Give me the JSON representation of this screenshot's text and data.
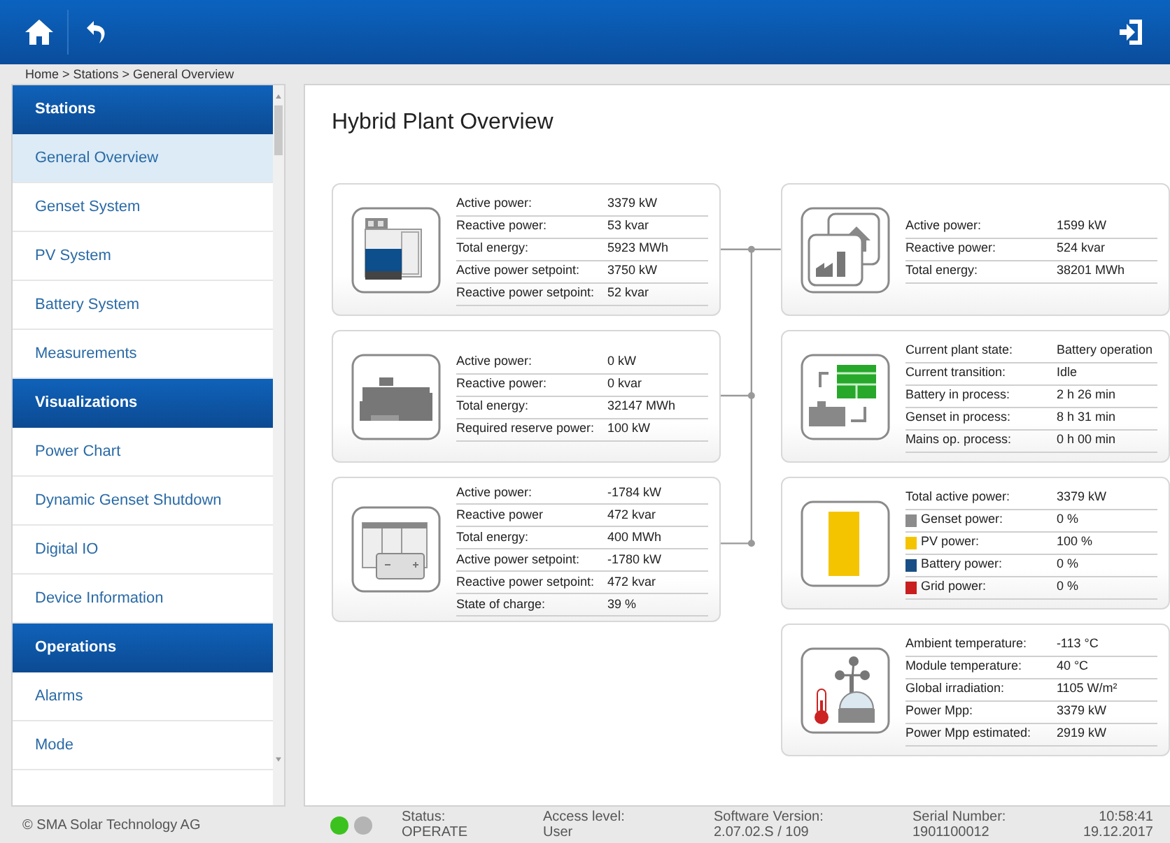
{
  "breadcrumb": "Home > Stations > General Overview",
  "sidebar": {
    "sections": [
      {
        "title": "Stations",
        "items": [
          {
            "label": "General Overview",
            "selected": true
          },
          {
            "label": "Genset System",
            "selected": false
          },
          {
            "label": "PV System",
            "selected": false
          },
          {
            "label": "Battery System",
            "selected": false
          },
          {
            "label": "Measurements",
            "selected": false
          }
        ]
      },
      {
        "title": "Visualizations",
        "items": [
          {
            "label": "Power Chart",
            "selected": false
          },
          {
            "label": "Dynamic Genset Shutdown",
            "selected": false
          },
          {
            "label": "Digital IO",
            "selected": false
          },
          {
            "label": "Device Information",
            "selected": false
          }
        ]
      },
      {
        "title": "Operations",
        "items": [
          {
            "label": "Alarms",
            "selected": false
          },
          {
            "label": "Mode",
            "selected": false
          }
        ]
      }
    ]
  },
  "page_title": "Hybrid Plant Overview",
  "left_cards": [
    {
      "kind": "pv_station",
      "rows": [
        {
          "label": "Active power:",
          "value": "3379 kW"
        },
        {
          "label": "Reactive power:",
          "value": "53 kvar"
        },
        {
          "label": "Total energy:",
          "value": "5923 MWh"
        },
        {
          "label": "Active power setpoint:",
          "value": "3750 kW"
        },
        {
          "label": "Reactive power setpoint:",
          "value": "52 kvar"
        }
      ]
    },
    {
      "kind": "genset",
      "rows": [
        {
          "label": "Active power:",
          "value": "0 kW"
        },
        {
          "label": "Reactive power:",
          "value": "0 kvar"
        },
        {
          "label": "Total energy:",
          "value": "32147 MWh"
        },
        {
          "label": "Required reserve power:",
          "value": "100 kW"
        }
      ]
    },
    {
      "kind": "battery",
      "rows": [
        {
          "label": "Active power:",
          "value": "-1784 kW"
        },
        {
          "label": "Reactive power",
          "value": "472 kvar"
        },
        {
          "label": "Total energy:",
          "value": "400 MWh"
        },
        {
          "label": "Active power setpoint:",
          "value": "-1780 kW"
        },
        {
          "label": "Reactive power setpoint:",
          "value": "472 kvar"
        },
        {
          "label": "State of charge:",
          "value": "39 %"
        }
      ]
    }
  ],
  "right_cards": [
    {
      "kind": "grid",
      "rows": [
        {
          "label": "Active power:",
          "value": "1599 kW"
        },
        {
          "label": "Reactive power:",
          "value": "524 kvar"
        },
        {
          "label": "Total energy:",
          "value": "38201 MWh"
        }
      ]
    },
    {
      "kind": "plant_state",
      "rows": [
        {
          "label": "Current plant state:",
          "value": "Battery operation"
        },
        {
          "label": "Current transition:",
          "value": "Idle"
        },
        {
          "label": "Battery in process:",
          "value": "2 h 26 min"
        },
        {
          "label": "Genset in process:",
          "value": "8 h 31 min"
        },
        {
          "label": "Mains op. process:",
          "value": "0 h 00 min"
        }
      ]
    },
    {
      "kind": "power_mix",
      "rows": [
        {
          "label": "Total active power:",
          "value": "3379 kW"
        },
        {
          "label": "Genset power:",
          "value": "0 %",
          "color": "#8c8c8c"
        },
        {
          "label": "PV power:",
          "value": "100 %",
          "color": "#f5c400"
        },
        {
          "label": "Battery power:",
          "value": "0 %",
          "color": "#1a4f85"
        },
        {
          "label": "Grid power:",
          "value": "0 %",
          "color": "#c81e1e"
        }
      ]
    },
    {
      "kind": "weather",
      "rows": [
        {
          "label": "Ambient temperature:",
          "value": "-113 °C"
        },
        {
          "label": "Module temperature:",
          "value": "40 °C"
        },
        {
          "label": "Global irradiation:",
          "value": "1105 W/m²"
        },
        {
          "label": "Power Mpp:",
          "value": "3379 kW"
        },
        {
          "label": "Power Mpp estimated:",
          "value": "2919 kW"
        }
      ]
    }
  ],
  "footer": {
    "copyright": "© SMA Solar Technology AG",
    "leds": [
      {
        "color": "#3cc21e"
      },
      {
        "color": "#b4b4b4"
      }
    ],
    "fields": [
      {
        "label": "Status:",
        "value": "OPERATE"
      },
      {
        "label": "Access level:",
        "value": "User"
      },
      {
        "label": "Software Version:",
        "value": "2.07.02.S / 109"
      },
      {
        "label": "Serial Number:",
        "value": "1901100012"
      }
    ],
    "time": "10:58:41",
    "date": "19.12.2017"
  }
}
